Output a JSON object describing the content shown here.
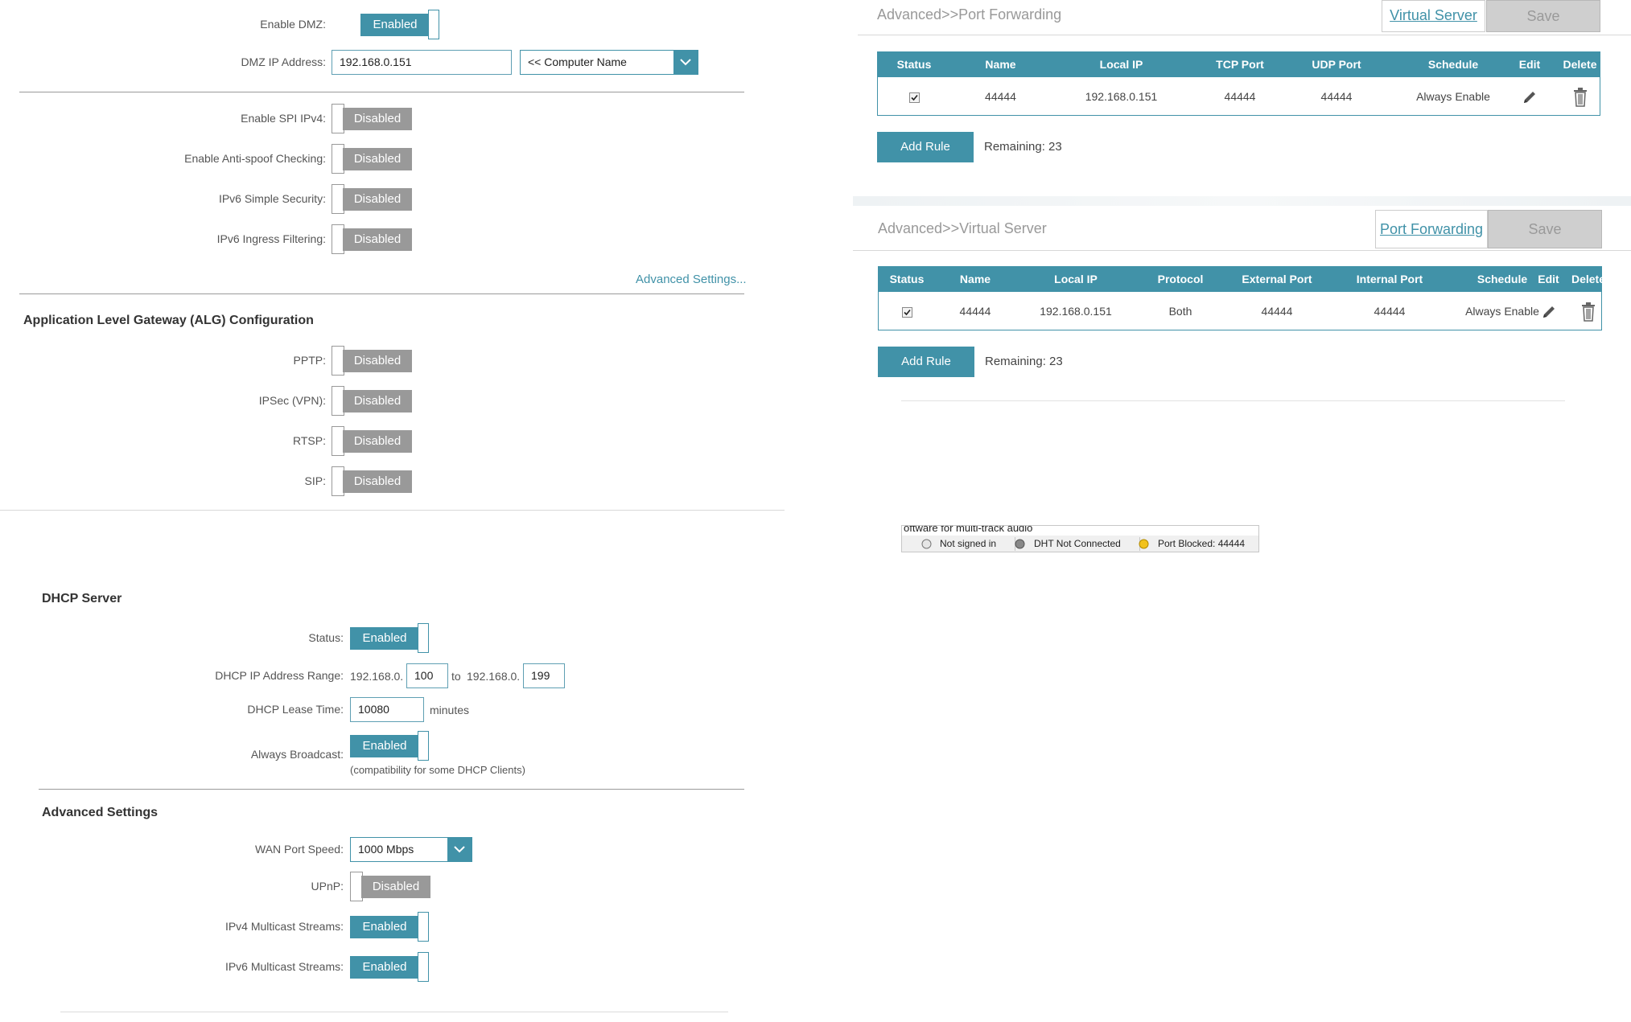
{
  "firewall": {
    "dmz_label": "Enable DMZ:",
    "dmz_state": "Enabled",
    "dmz_ip_label": "DMZ IP Address:",
    "dmz_ip_value": "192.168.0.151",
    "computer_name_select": "<< Computer Name",
    "spi_label": "Enable SPI IPv4:",
    "spi_state": "Disabled",
    "antispoof_label": "Enable Anti-spoof Checking:",
    "antispoof_state": "Disabled",
    "ipv6_simple_label": "IPv6 Simple Security:",
    "ipv6_simple_state": "Disabled",
    "ipv6_ingress_label": "IPv6 Ingress Filtering:",
    "ipv6_ingress_state": "Disabled",
    "advanced_link": "Advanced Settings..."
  },
  "alg": {
    "title": "Application Level Gateway (ALG) Configuration",
    "pptp_label": "PPTP:",
    "pptp_state": "Disabled",
    "ipsec_label": "IPSec (VPN):",
    "ipsec_state": "Disabled",
    "rtsp_label": "RTSP:",
    "rtsp_state": "Disabled",
    "sip_label": "SIP:",
    "sip_state": "Disabled"
  },
  "dhcp": {
    "title": "DHCP Server",
    "status_label": "Status:",
    "status_state": "Enabled",
    "range_label": "DHCP IP Address Range:",
    "range_prefix_start": "192.168.0.",
    "range_start": "100",
    "range_to": "to",
    "range_prefix_end": "192.168.0.",
    "range_end": "199",
    "lease_label": "DHCP Lease Time:",
    "lease_value": "10080",
    "lease_unit": "minutes",
    "broadcast_label": "Always Broadcast:",
    "broadcast_state": "Enabled",
    "broadcast_note": "(compatibility for some DHCP Clients)"
  },
  "advanced": {
    "title": "Advanced Settings",
    "wan_label": "WAN Port Speed:",
    "wan_value": "1000 Mbps",
    "upnp_label": "UPnP:",
    "upnp_state": "Disabled",
    "ipv4_multicast_label": "IPv4 Multicast Streams:",
    "ipv4_multicast_state": "Enabled",
    "ipv6_multicast_label": "IPv6 Multicast Streams:",
    "ipv6_multicast_state": "Enabled"
  },
  "port_forwarding": {
    "breadcrumb": "Advanced>>Port Forwarding",
    "tab_link": "Virtual Server",
    "save": "Save",
    "headers": [
      "Status",
      "Name",
      "Local IP",
      "TCP Port",
      "UDP Port",
      "Schedule",
      "Edit",
      "Delete"
    ],
    "row": {
      "name": "44444",
      "local_ip": "192.168.0.151",
      "tcp": "44444",
      "udp": "44444",
      "schedule": "Always Enable"
    },
    "add_rule": "Add Rule",
    "remaining": "Remaining: 23"
  },
  "virtual_server": {
    "breadcrumb": "Advanced>>Virtual Server",
    "tab_link": "Port Forwarding",
    "save": "Save",
    "headers": [
      "Status",
      "Name",
      "Local IP",
      "Protocol",
      "External Port",
      "Internal Port",
      "Schedule",
      "Edit",
      "Delete"
    ],
    "row": {
      "name": "44444",
      "local_ip": "192.168.0.151",
      "protocol": "Both",
      "external": "44444",
      "internal": "44444",
      "schedule": "Always Enable"
    },
    "add_rule": "Add Rule",
    "remaining": "Remaining: 23"
  },
  "statusbar": {
    "partial_text": "oftware for multi-track audio",
    "signed_in": "Not signed in",
    "dht": "DHT Not Connected",
    "port": "Port Blocked: 44444"
  },
  "colors": {
    "accent": "#4192a8",
    "disabled": "#999999"
  }
}
